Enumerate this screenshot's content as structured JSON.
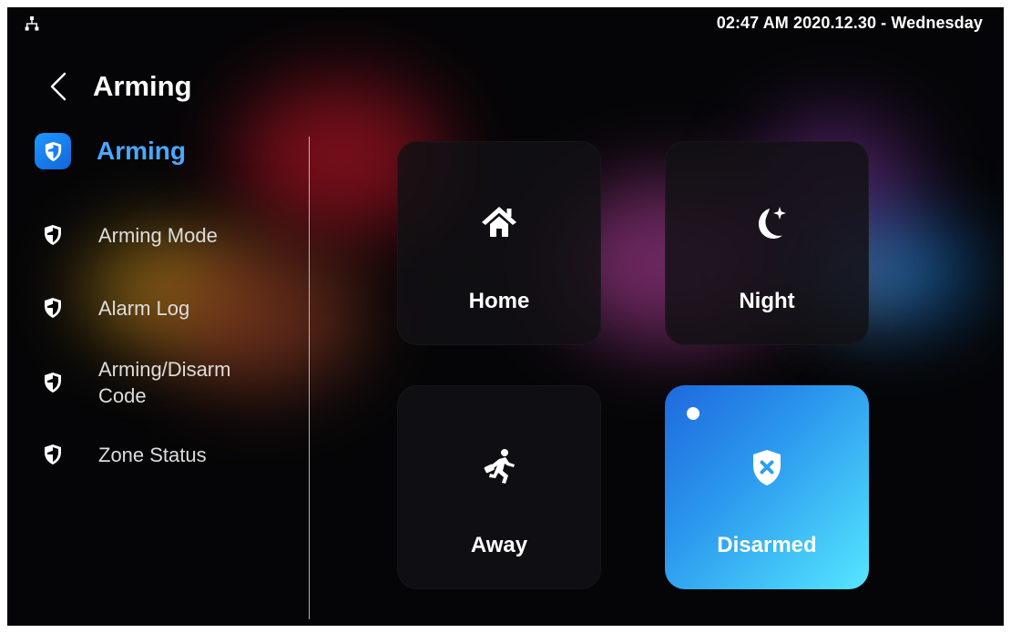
{
  "status_bar": {
    "time_date": "02:47 AM  2020.12.30 - Wednesday",
    "network_icon": "network-icon"
  },
  "header": {
    "back_icon": "chevron-left-icon",
    "title": "Arming"
  },
  "sidebar": {
    "items": [
      {
        "label": "Arming",
        "icon": "shield-icon",
        "active": true
      },
      {
        "label": "Arming Mode",
        "icon": "shield-icon",
        "active": false
      },
      {
        "label": "Alarm Log",
        "icon": "shield-icon",
        "active": false
      },
      {
        "label": "Arming/Disarm Code",
        "icon": "shield-icon",
        "active": false
      },
      {
        "label": "Zone Status",
        "icon": "shield-icon",
        "active": false
      }
    ]
  },
  "modes": [
    {
      "label": "Home",
      "icon": "house-icon",
      "active": false
    },
    {
      "label": "Night",
      "icon": "moon-star-icon",
      "active": false
    },
    {
      "label": "Away",
      "icon": "running-person-icon",
      "active": false
    },
    {
      "label": "Disarmed",
      "icon": "shield-x-icon",
      "active": true
    }
  ],
  "colors": {
    "screen_background": "#050507",
    "accent_blue": "#48a9ff",
    "active_tile_start": "#1f69dd",
    "active_tile_end": "#55e7ff",
    "tile_dark": "#121114"
  }
}
